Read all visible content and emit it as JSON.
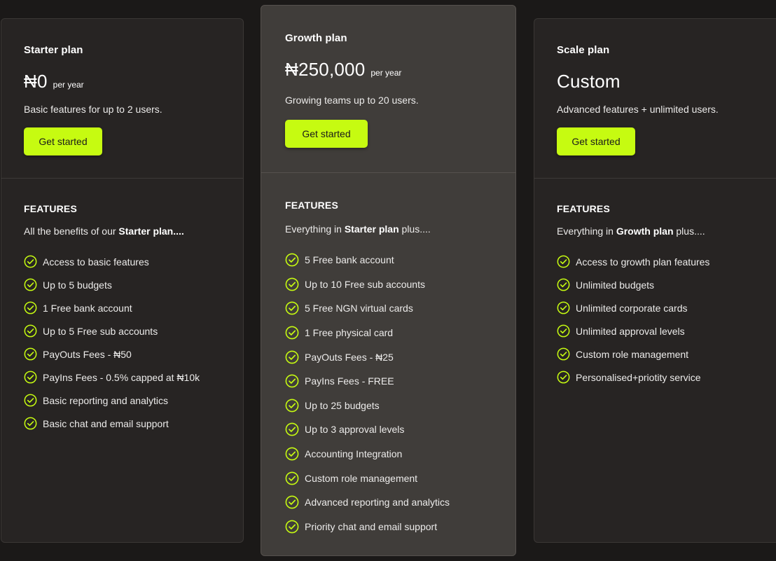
{
  "plans": {
    "starter": {
      "name": "Starter plan",
      "price": "₦0",
      "period": "per year",
      "description": "Basic features for up to 2 users.",
      "cta": "Get started",
      "features_title": "FEATURES",
      "intro_prefix": "All the benefits of our ",
      "intro_bold": "Starter plan....",
      "intro_suffix": "",
      "features": [
        "Access to basic features",
        "Up to 5 budgets",
        "1 Free bank account",
        "Up to 5 Free sub accounts",
        "PayOuts Fees - ₦50",
        "PayIns Fees - 0.5% capped at ₦10k",
        "Basic reporting and analytics",
        "Basic chat and email support"
      ]
    },
    "growth": {
      "name": "Growth plan",
      "price": "₦250,000",
      "period": "per year",
      "description": "Growing teams up to 20 users.",
      "cta": "Get started",
      "features_title": "FEATURES",
      "intro_prefix": "Everything in ",
      "intro_bold": "Starter plan",
      "intro_suffix": " plus....",
      "features": [
        "5 Free bank account",
        "Up to 10 Free sub accounts",
        "5 Free NGN virtual cards",
        "1 Free physical card",
        "PayOuts Fees - ₦25",
        "PayIns Fees - FREE",
        "Up to 25 budgets",
        "Up to 3 approval levels",
        "Accounting Integration",
        "Custom role management",
        "Advanced reporting and analytics",
        "Priority chat and email support"
      ]
    },
    "scale": {
      "name": "Scale plan",
      "price": "Custom",
      "period": "",
      "description": "Advanced features + unlimited users.",
      "cta": "Get started",
      "features_title": "FEATURES",
      "intro_prefix": "Everything in ",
      "intro_bold": "Growth plan",
      "intro_suffix": " plus....",
      "features": [
        "Access to growth plan features",
        "Unlimited budgets",
        "Unlimited corporate cards",
        "Unlimited approval levels",
        "Custom role management",
        "Personalised+priotity service"
      ]
    }
  },
  "colors": {
    "accent": "#c6fb11",
    "background": "#1b1918",
    "card": "#272423",
    "card_highlight": "#403d3a"
  },
  "icons": {
    "feature_bullet": "check-circle-icon"
  }
}
